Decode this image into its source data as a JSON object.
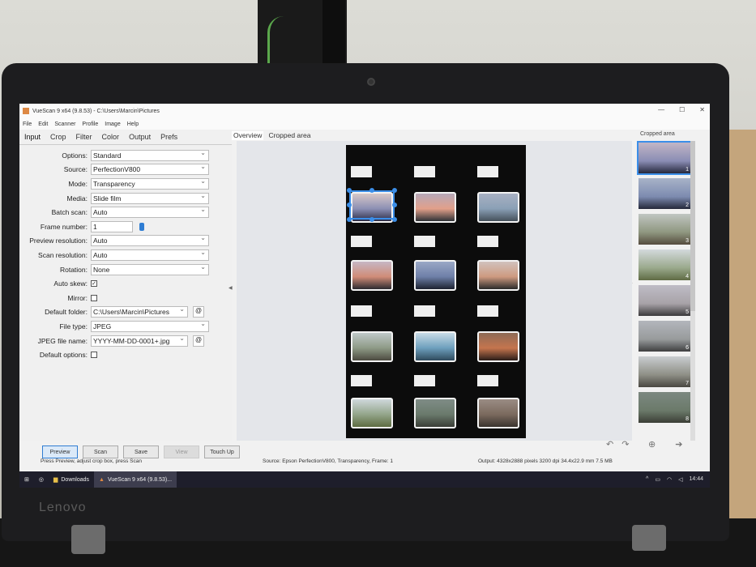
{
  "window": {
    "title": "VueScan 9 x64 (9.8.53) - C:\\Users\\Marcin\\Pictures",
    "controls": [
      "—",
      "☐",
      "✕"
    ]
  },
  "menu": [
    "File",
    "Edit",
    "Scanner",
    "Profile",
    "Image",
    "Help"
  ],
  "left_tabs": [
    "Input",
    "Crop",
    "Filter",
    "Color",
    "Output",
    "Prefs"
  ],
  "settings": {
    "options": {
      "label": "Options:",
      "value": "Standard"
    },
    "source": {
      "label": "Source:",
      "value": "PerfectionV800"
    },
    "mode": {
      "label": "Mode:",
      "value": "Transparency"
    },
    "media": {
      "label": "Media:",
      "value": "Slide film"
    },
    "batch_scan": {
      "label": "Batch scan:",
      "value": "Auto"
    },
    "frame_number": {
      "label": "Frame number:",
      "value": "1"
    },
    "preview_resolution": {
      "label": "Preview resolution:",
      "value": "Auto"
    },
    "scan_resolution": {
      "label": "Scan resolution:",
      "value": "Auto"
    },
    "rotation": {
      "label": "Rotation:",
      "value": "None"
    },
    "auto_skew": {
      "label": "Auto skew:",
      "mark": "✓"
    },
    "mirror": {
      "label": "Mirror:"
    },
    "default_folder": {
      "label": "Default folder:",
      "value": "C:\\Users\\Marcin\\Pictures",
      "at": "@"
    },
    "file_type": {
      "label": "File type:",
      "value": "JPEG"
    },
    "jpeg_file_name": {
      "label": "JPEG file name:",
      "value": "YYYY-MM-DD-0001+.jpg",
      "at": "@"
    },
    "default_options": {
      "label": "Default options:"
    }
  },
  "buttons": {
    "preview": "Preview",
    "scan": "Scan",
    "save": "Save",
    "view": "View",
    "touch_up": "Touch Up"
  },
  "view_tabs": [
    "Overview",
    "Cropped area"
  ],
  "thumbnails": {
    "header": "Cropped area",
    "items": [
      "1",
      "2",
      "3",
      "4",
      "5",
      "6",
      "7",
      "8"
    ]
  },
  "view_tools": {
    "rotate_left": "↶",
    "rotate_right": "↷",
    "zoom": "⊕",
    "next": "➔"
  },
  "status": {
    "hint": "Press Preview, adjust crop box, press Scan",
    "source": "Source: Epson PerfectionV800, Transparency, Frame: 1",
    "output": "Output: 4328x2888 pixels 3200 dpi 34.4x22.9 mm 7.5 MB"
  },
  "taskbar": {
    "items": [
      {
        "label": "Downloads",
        "icon": "folder-icon"
      },
      {
        "label": "VueScan 9 x64 (9.8.53)...",
        "icon": "vuescan-icon"
      }
    ],
    "clock": "14:44"
  },
  "device": {
    "brand": "Lenovo"
  },
  "colors": {
    "accent": "#3b8ee8",
    "filmstrip": "#0c0c0c",
    "taskbar": "#1e1e2b"
  }
}
